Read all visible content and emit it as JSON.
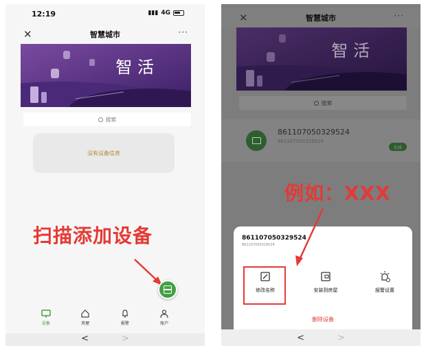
{
  "left_phone": {
    "status": {
      "time": "12:19",
      "network": "4G"
    },
    "navbar": {
      "title": "智慧城市",
      "close_glyph": "✕",
      "more_glyph": "···"
    },
    "banner": {
      "text": "智 活"
    },
    "search": {
      "placeholder": "搜索"
    },
    "empty_state": {
      "text": "没有设备信息"
    },
    "annotation": "扫描添加设备",
    "tabs": [
      {
        "label": "设备",
        "icon": "monitor-icon",
        "active": true
      },
      {
        "label": "房屋",
        "icon": "home-icon",
        "active": false
      },
      {
        "label": "报警",
        "icon": "bell-icon",
        "active": false
      },
      {
        "label": "账户",
        "icon": "user-icon",
        "active": false
      }
    ],
    "bottom_nav": {
      "back": "<",
      "forward": ">"
    }
  },
  "right_phone": {
    "navbar": {
      "title": "智慧城市",
      "close_glyph": "✕",
      "more_glyph": "···"
    },
    "banner": {
      "text": "智 活"
    },
    "search": {
      "placeholder": "搜索"
    },
    "device": {
      "name": "861107050329524",
      "sub": "861107050329524",
      "status": "在线"
    },
    "annotation": "例如：XXX",
    "sheet": {
      "title": "861107050329524",
      "subtitle": "861107050329524",
      "actions": [
        {
          "label": "修改名称",
          "icon": "edit-icon"
        },
        {
          "label": "安装到房屋",
          "icon": "install-icon"
        },
        {
          "label": "报警设置",
          "icon": "alarm-settings-icon"
        }
      ],
      "delete_label": "删除设备"
    },
    "bottom_nav": {
      "back": "<",
      "forward": ">"
    }
  },
  "colors": {
    "accent_green": "#43a047",
    "annotation_red": "#e53935",
    "banner_purple": "#5b3a8a"
  }
}
